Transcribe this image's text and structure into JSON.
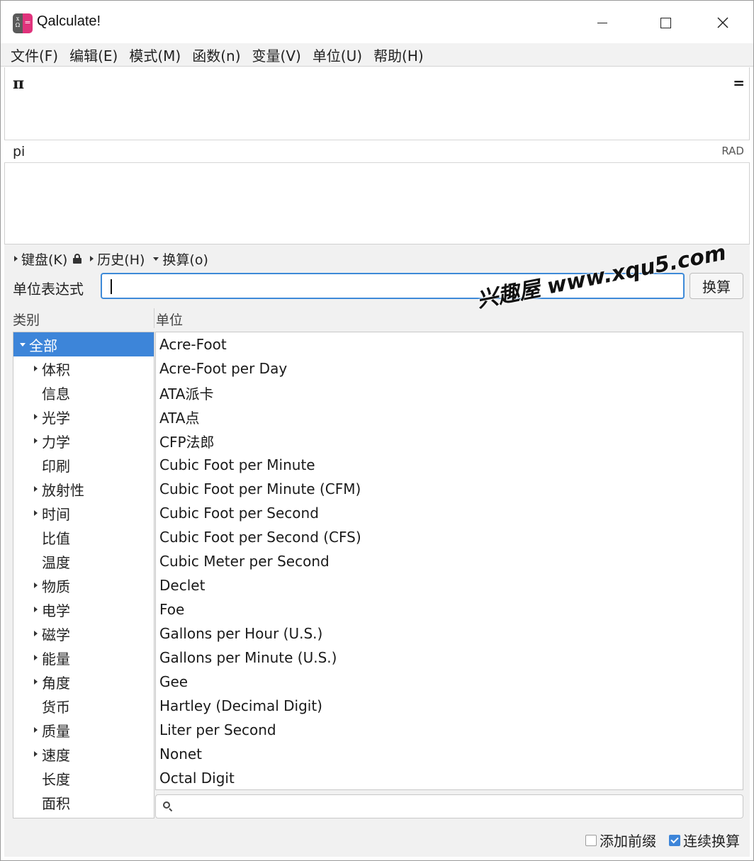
{
  "window": {
    "title": "Qalculate!",
    "icon_left_top": "x",
    "icon_left_bottom": "Ω",
    "icon_right": "="
  },
  "menu": [
    "文件(F)",
    "编辑(E)",
    "模式(M)",
    "函数(n)",
    "变量(V)",
    "单位(U)",
    "帮助(H)"
  ],
  "expression": {
    "text": "π",
    "equals": "="
  },
  "status": {
    "text": "pi",
    "angle_mode": "RAD"
  },
  "expanders": {
    "keyboard": "键盘(K)",
    "history": "历史(H)",
    "conversion": "换算(o)"
  },
  "conversion": {
    "label": "单位表达式",
    "input_value": "",
    "button": "换算"
  },
  "columns": {
    "category": "类别",
    "unit": "单位"
  },
  "categories": [
    {
      "label": "全部",
      "expandable": true,
      "expanded": true,
      "level": 0,
      "selected": true
    },
    {
      "label": "体积",
      "expandable": true,
      "level": 1
    },
    {
      "label": "信息",
      "expandable": false,
      "level": 1
    },
    {
      "label": "光学",
      "expandable": true,
      "level": 1
    },
    {
      "label": "力学",
      "expandable": true,
      "level": 1
    },
    {
      "label": "印刷",
      "expandable": false,
      "level": 1
    },
    {
      "label": "放射性",
      "expandable": true,
      "level": 1
    },
    {
      "label": "时间",
      "expandable": true,
      "level": 1
    },
    {
      "label": "比值",
      "expandable": false,
      "level": 1
    },
    {
      "label": "温度",
      "expandable": false,
      "level": 1
    },
    {
      "label": "物质",
      "expandable": true,
      "level": 1
    },
    {
      "label": "电学",
      "expandable": true,
      "level": 1
    },
    {
      "label": "磁学",
      "expandable": true,
      "level": 1
    },
    {
      "label": "能量",
      "expandable": true,
      "level": 1
    },
    {
      "label": "角度",
      "expandable": true,
      "level": 1
    },
    {
      "label": "货币",
      "expandable": false,
      "level": 1
    },
    {
      "label": "质量",
      "expandable": true,
      "level": 1
    },
    {
      "label": "速度",
      "expandable": true,
      "level": 1
    },
    {
      "label": "长度",
      "expandable": false,
      "level": 1
    },
    {
      "label": "面积",
      "expandable": false,
      "level": 1
    }
  ],
  "units": [
    "Acre-Foot",
    "Acre-Foot per Day",
    "ATA派卡",
    "ATA点",
    "CFP法郎",
    "Cubic Foot per Minute",
    "Cubic Foot per Minute (CFM)",
    "Cubic Foot per Second",
    "Cubic Foot per Second (CFS)",
    "Cubic Meter per Second",
    "Declet",
    "Foe",
    "Gallons per Hour (U.S.)",
    "Gallons per Minute (U.S.)",
    "Gee",
    "Hartley (Decimal Digit)",
    "Liter per Second",
    "Nonet",
    "Octal Digit"
  ],
  "search": {
    "value": ""
  },
  "options": {
    "add_prefix": {
      "label": "添加前缀",
      "checked": false
    },
    "continuous": {
      "label": "连续换算",
      "checked": true
    }
  },
  "watermark": "兴趣屋 www.xqu5.com",
  "colors": {
    "accent": "#3d85d9",
    "input_focus": "#3e8ad8",
    "icon_pink": "#e0337c"
  }
}
